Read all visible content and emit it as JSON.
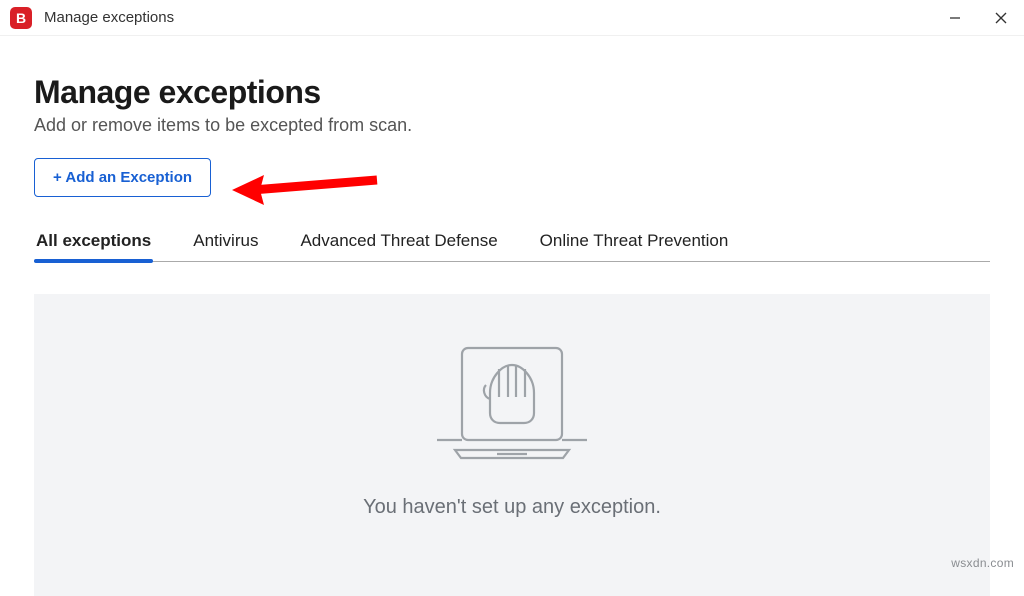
{
  "window": {
    "app_letter": "B",
    "title": "Manage exceptions"
  },
  "header": {
    "title": "Manage exceptions",
    "subtitle": "Add or remove items to be excepted from scan."
  },
  "add_button": {
    "label": "+ Add an Exception"
  },
  "tabs": [
    {
      "label": "All exceptions",
      "active": true
    },
    {
      "label": "Antivirus",
      "active": false
    },
    {
      "label": "Advanced Threat Defense",
      "active": false
    },
    {
      "label": "Online Threat Prevention",
      "active": false
    }
  ],
  "empty_state": {
    "message": "You haven't set up any exception."
  },
  "watermark": "wsxdn.com"
}
